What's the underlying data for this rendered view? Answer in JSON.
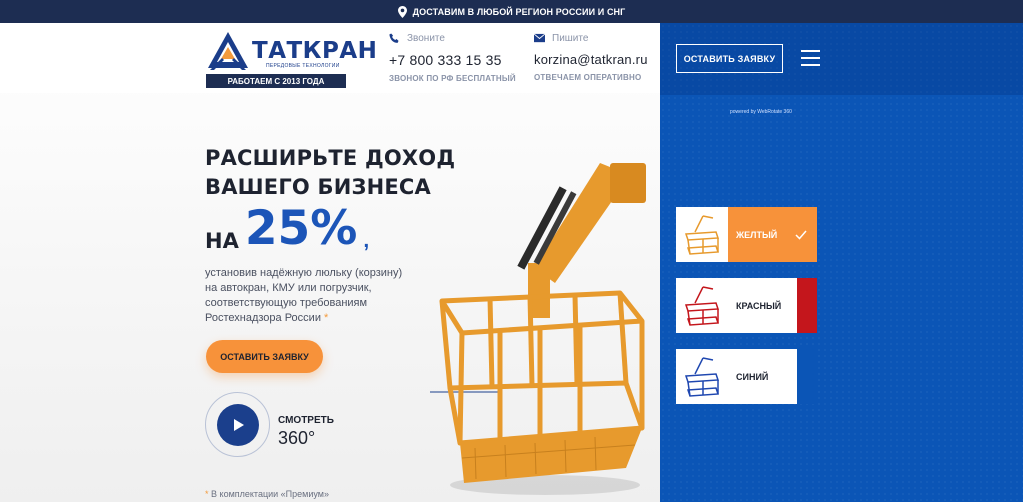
{
  "topbar": {
    "text": "ДОСТАВИМ В ЛЮБОЙ РЕГИОН РОССИИ И СНГ",
    "icon": "location-pin-icon"
  },
  "logo": {
    "name": "ТАТКРАН",
    "tagline": "ПЕРЕДОВЫЕ ТЕХНОЛОГИИ",
    "since": "РАБОТАЕМ С 2013 ГОДА"
  },
  "contacts": {
    "phone": {
      "label": "Звоните",
      "value": "+7 800 333 15 35",
      "note": "ЗВОНОК ПО РФ БЕСПЛАТНЫЙ",
      "icon": "phone-icon"
    },
    "email": {
      "label": "Пишите",
      "value": "korzina@tatkran.ru",
      "note": "ОТВЕЧАЕМ ОПЕРАТИВНО",
      "icon": "mail-icon"
    }
  },
  "hero": {
    "title_line1": "РАСШИРЬТЕ ДОХОД",
    "title_line2": "ВАШЕГО БИЗНЕСА",
    "prefix": "НА",
    "percent": "25%",
    "comma": ",",
    "desc_line1": "установив надёжную люльку (корзину)",
    "desc_line2": "на автокран, КМУ или погрузчик,",
    "desc_line3": "соответствующую требованиям",
    "desc_line4": "Ростехнадзора России",
    "asterisk": "*",
    "cta": "ОСТАВИТЬ ЗАЯВКУ",
    "watch_line1": "СМОТРЕТЬ",
    "watch_line2": "360°",
    "premium": "В комплектации «Премиум»"
  },
  "panel": {
    "apply": "ОСТАВИТЬ ЗАЯВКУ",
    "powered": "powered by WebRotate 360",
    "options": [
      {
        "label": "ЖЕЛТЫЙ",
        "color": "#f0a53a",
        "selected": true
      },
      {
        "label": "КРАСНЫЙ",
        "color": "#c4161c",
        "selected": false
      },
      {
        "label": "СИНИЙ",
        "color": "#0b55b6",
        "selected": false
      }
    ]
  },
  "colors": {
    "accent": "#f7923a",
    "brand": "#1b3d8a",
    "panel": "#0b55b6",
    "topbar": "#1d2d52"
  }
}
